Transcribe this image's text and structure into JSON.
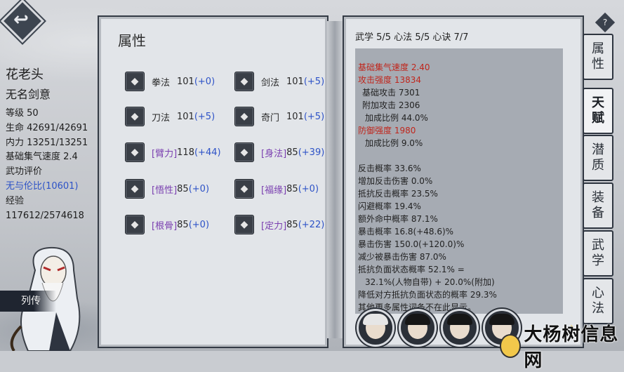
{
  "character": {
    "name": "花老头",
    "title": "无名剑意",
    "level": "等级 50",
    "hp": "生命 42691/42691",
    "mp": "内力 13251/13251",
    "qi_speed": "基础集气速度 2.4",
    "rating_label": "武功评价",
    "rating_value": "无与伦比(10601)",
    "exp_label": "经验",
    "exp_value": "117612/2574618",
    "biography_button": "列传"
  },
  "left_page": {
    "title": "属性",
    "stats": [
      {
        "icon": "fist-icon",
        "name": "拳法",
        "value": "101",
        "bonus": "(+0)"
      },
      {
        "icon": "sword-icon",
        "name": "剑法",
        "value": "101",
        "bonus": "(+5)"
      },
      {
        "icon": "blade-icon",
        "name": "刀法",
        "value": "101",
        "bonus": "(+5)"
      },
      {
        "icon": "dart-icon",
        "name": "奇门",
        "value": "101",
        "bonus": "(+5)"
      },
      {
        "icon": "arm-icon",
        "name": "[臂力]",
        "value": "118",
        "bonus": "(+44)"
      },
      {
        "icon": "running-icon",
        "name": "[身法]",
        "value": "85",
        "bonus": "(+39)"
      },
      {
        "icon": "mind-icon",
        "name": "[悟性]",
        "value": "85",
        "bonus": "(+0)"
      },
      {
        "icon": "fortune-icon",
        "name": "[福缘]",
        "value": "85",
        "bonus": "(+0)"
      },
      {
        "icon": "bone-icon",
        "name": "[根骨]",
        "value": "85",
        "bonus": "(+0)"
      },
      {
        "icon": "meditate-icon",
        "name": "[定力]",
        "value": "85",
        "bonus": "(+22)"
      }
    ]
  },
  "right_page": {
    "header": "武学 5/5  心法 5/5  心诀 7/7",
    "lines": [
      {
        "text": "基础集气速度 2.40",
        "style": "red"
      },
      {
        "text": "攻击强度 13834",
        "style": "red"
      },
      {
        "text": "基础攻击 7301",
        "style": "indent"
      },
      {
        "text": "附加攻击 2306",
        "style": "indent"
      },
      {
        "text": "加成比例 44.0%",
        "style": "indent2"
      },
      {
        "text": "防御强度 1980",
        "style": "red"
      },
      {
        "text": "加成比例 9.0%",
        "style": "indent2"
      },
      {
        "text": "",
        "style": "blank"
      },
      {
        "text": "反击概率 33.6%",
        "style": "normal"
      },
      {
        "text": "增加反击伤害 0.0%",
        "style": "normal"
      },
      {
        "text": "抵抗反击概率 23.5%",
        "style": "normal"
      },
      {
        "text": "闪避概率 19.4%",
        "style": "normal"
      },
      {
        "text": "额外命中概率 87.1%",
        "style": "normal"
      },
      {
        "text": "暴击概率 16.8(+48.6)%",
        "style": "normal"
      },
      {
        "text": "暴击伤害 150.0(+120.0)%",
        "style": "normal"
      },
      {
        "text": "减少被暴击伤害 87.0%",
        "style": "normal"
      },
      {
        "text": "抵抗负面状态概率 52.1% =",
        "style": "normal"
      },
      {
        "text": "32.1%(人物自带) + 20.0%(附加)",
        "style": "indent2"
      },
      {
        "text": "降低对方抵抗负面状态的概率 29.3%",
        "style": "normal"
      },
      {
        "text": "其他更多属性词条不在此显示。",
        "style": "normal"
      }
    ]
  },
  "tabs": [
    {
      "label": "属\n性",
      "active": false
    },
    {
      "label": "天\n赋",
      "active": true
    },
    {
      "label": "潜\n质",
      "active": false
    },
    {
      "label": "装\n备",
      "active": false
    },
    {
      "label": "武\n学",
      "active": false
    },
    {
      "label": "心\n法",
      "active": false
    }
  ],
  "help_label": "?",
  "party": [
    "white-haired-elder",
    "young-woman",
    "maiden",
    "young-man"
  ],
  "watermark": "大杨树信息网",
  "colors": {
    "highlight_blue": "#2d52c7",
    "red": "#c0261c",
    "attr_purple": "#7a3fb0"
  }
}
